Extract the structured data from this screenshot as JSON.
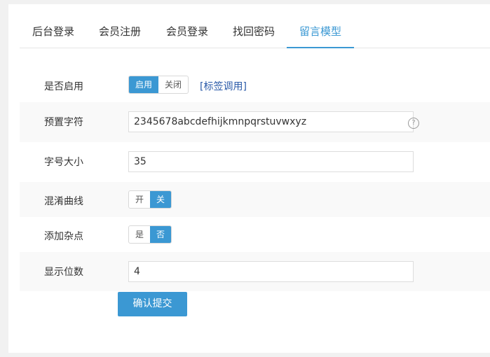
{
  "tabs": [
    {
      "label": "后台登录",
      "active": false
    },
    {
      "label": "会员注册",
      "active": false
    },
    {
      "label": "会员登录",
      "active": false
    },
    {
      "label": "找回密码",
      "active": false
    },
    {
      "label": "留言模型",
      "active": true
    }
  ],
  "form": {
    "enable": {
      "label": "是否启用",
      "on": "启用",
      "off": "关闭",
      "selected": "启用",
      "tag_link": "[标签调用]"
    },
    "charset": {
      "label": "预置字符",
      "value": "2345678abcdefhijkmnpqrstuvwxyz",
      "help_icon": "?"
    },
    "font_size": {
      "label": "字号大小",
      "value": "35"
    },
    "curve": {
      "label": "混淆曲线",
      "on": "开",
      "off": "关",
      "selected": "关"
    },
    "noise": {
      "label": "添加杂点",
      "on": "是",
      "off": "否",
      "selected": "否"
    },
    "digits": {
      "label": "显示位数",
      "value": "4"
    },
    "submit_label": "确认提交"
  },
  "colors": {
    "accent": "#3b98d3",
    "link": "#2a5aa8"
  }
}
